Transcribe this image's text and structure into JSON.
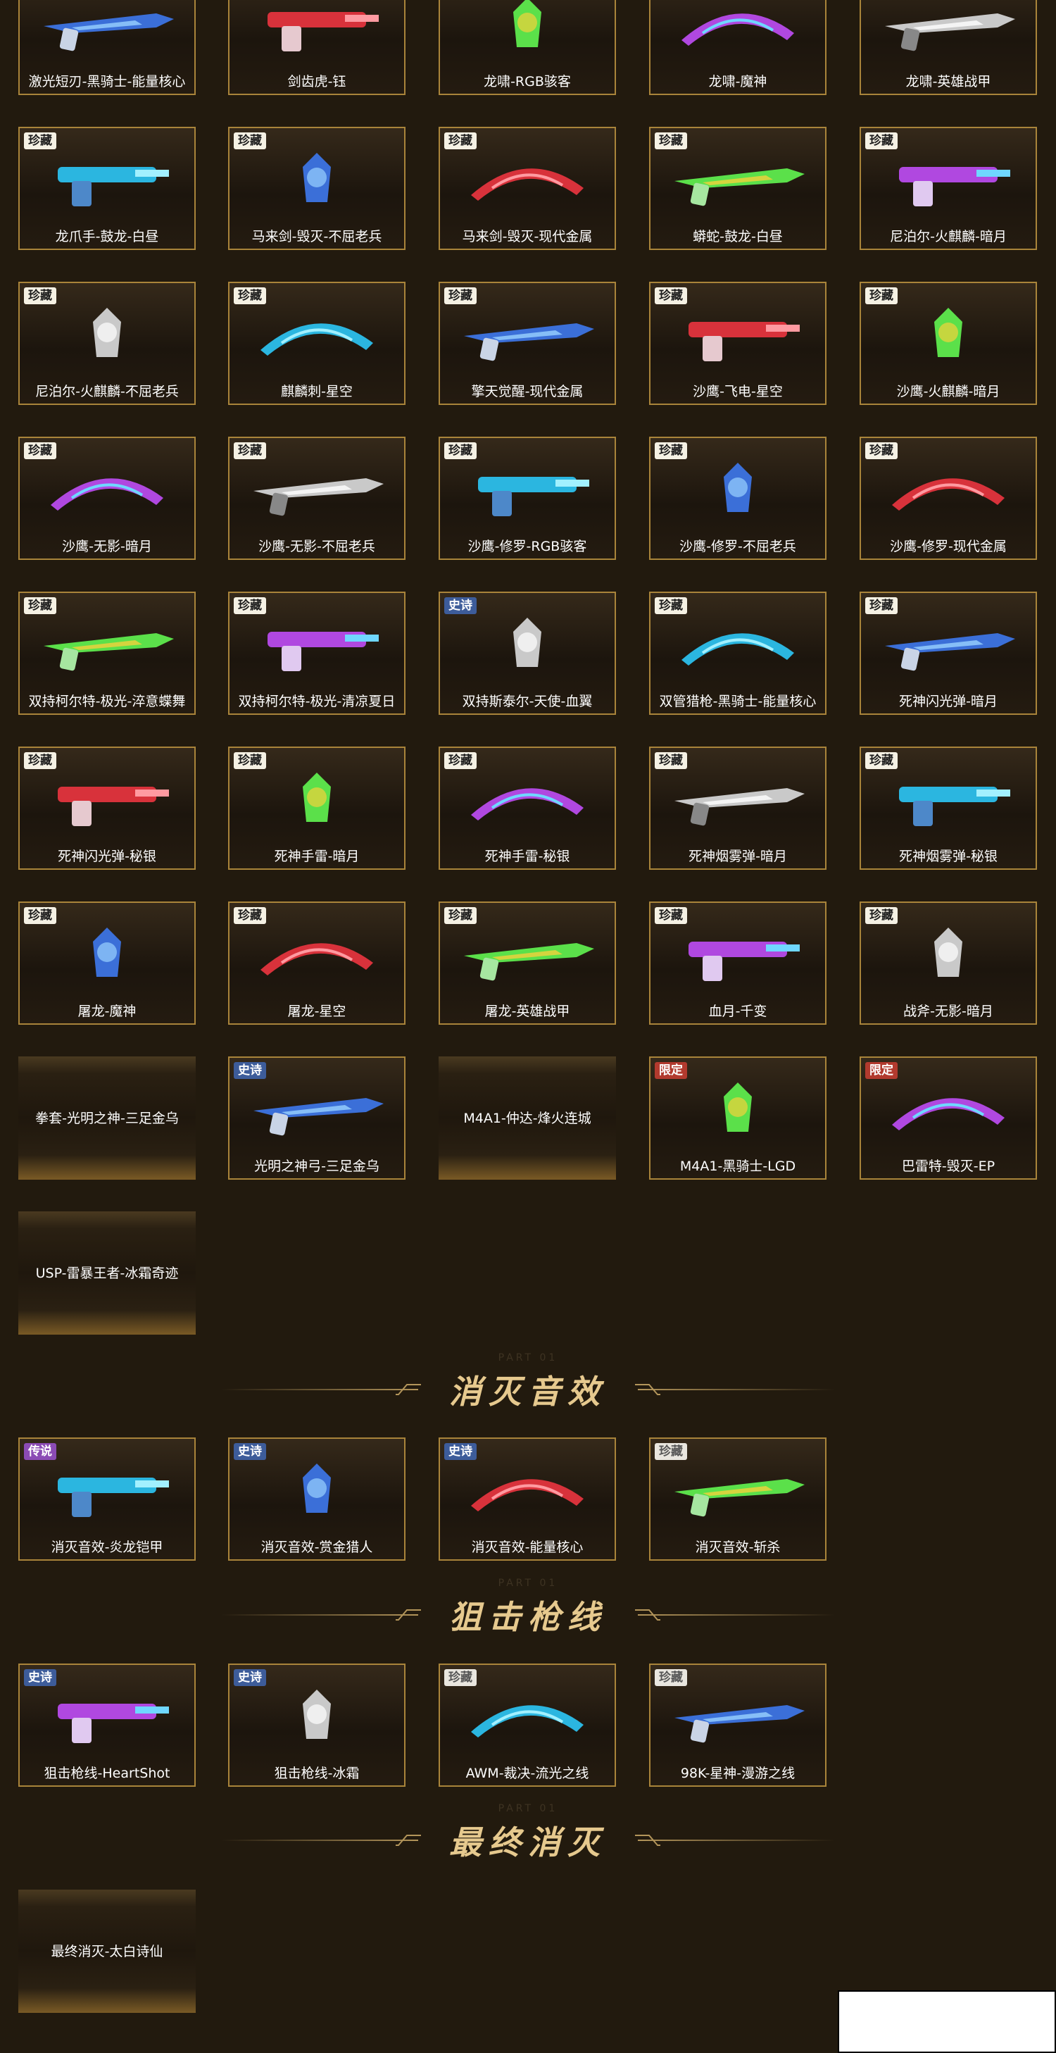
{
  "weapons": [
    [
      {
        "name": "激光短刃-黑骑士-能量核心",
        "badge": ""
      },
      {
        "name": "剑齿虎-钰",
        "badge": ""
      },
      {
        "name": "龙啸-RGB骇客",
        "badge": ""
      },
      {
        "name": "龙啸-魔神",
        "badge": ""
      },
      {
        "name": "龙啸-英雄战甲",
        "badge": ""
      }
    ],
    [
      {
        "name": "龙爪手-鼓龙-白昼",
        "badge": "珍藏"
      },
      {
        "name": "马来剑-毁灭-不屈老兵",
        "badge": "珍藏"
      },
      {
        "name": "马来剑-毁灭-现代金属",
        "badge": "珍藏"
      },
      {
        "name": "蟒蛇-鼓龙-白昼",
        "badge": "珍藏"
      },
      {
        "name": "尼泊尔-火麒麟-暗月",
        "badge": "珍藏"
      }
    ],
    [
      {
        "name": "尼泊尔-火麒麟-不屈老兵",
        "badge": "珍藏"
      },
      {
        "name": "麒麟刺-星空",
        "badge": "珍藏"
      },
      {
        "name": "擎天觉醒-现代金属",
        "badge": "珍藏"
      },
      {
        "name": "沙鹰-飞电-星空",
        "badge": "珍藏"
      },
      {
        "name": "沙鹰-火麒麟-暗月",
        "badge": "珍藏"
      }
    ],
    [
      {
        "name": "沙鹰-无影-暗月",
        "badge": "珍藏"
      },
      {
        "name": "沙鹰-无影-不屈老兵",
        "badge": "珍藏"
      },
      {
        "name": "沙鹰-修罗-RGB骇客",
        "badge": "珍藏"
      },
      {
        "name": "沙鹰-修罗-不屈老兵",
        "badge": "珍藏"
      },
      {
        "name": "沙鹰-修罗-现代金属",
        "badge": "珍藏"
      }
    ],
    [
      {
        "name": "双持柯尔特-极光-淬意蝶舞",
        "badge": "珍藏"
      },
      {
        "name": "双持柯尔特-极光-清凉夏日",
        "badge": "珍藏"
      },
      {
        "name": "双持斯泰尔-天使-血翼",
        "badge": "史诗"
      },
      {
        "name": "双管猎枪-黑骑士-能量核心",
        "badge": "珍藏"
      },
      {
        "name": "死神闪光弹-暗月",
        "badge": "珍藏"
      }
    ],
    [
      {
        "name": "死神闪光弹-秘银",
        "badge": "珍藏"
      },
      {
        "name": "死神手雷-暗月",
        "badge": "珍藏"
      },
      {
        "name": "死神手雷-秘银",
        "badge": "珍藏"
      },
      {
        "name": "死神烟雾弹-暗月",
        "badge": "珍藏"
      },
      {
        "name": "死神烟雾弹-秘银",
        "badge": "珍藏"
      }
    ],
    [
      {
        "name": "屠龙-魔神",
        "badge": "珍藏"
      },
      {
        "name": "屠龙-星空",
        "badge": "珍藏"
      },
      {
        "name": "屠龙-英雄战甲",
        "badge": "珍藏"
      },
      {
        "name": "血月-千变",
        "badge": "珍藏"
      },
      {
        "name": "战斧-无影-暗月",
        "badge": "珍藏"
      }
    ],
    [
      {
        "name": "拳套-光明之神-三足金乌",
        "badge": "",
        "plain": true
      },
      {
        "name": "光明之神弓-三足金乌",
        "badge": "史诗"
      },
      {
        "name": "M4A1-仲达-烽火连城",
        "badge": "",
        "plain": true
      },
      {
        "name": "M4A1-黑骑士-LGD",
        "badge": "限定"
      },
      {
        "name": "巴雷特-毁灭-EP",
        "badge": "限定"
      }
    ],
    [
      {
        "name": "USP-雷暴王者-冰霜奇迹",
        "badge": "",
        "plain": true
      }
    ]
  ],
  "sections": [
    {
      "title": "消灭音效",
      "part": "PART 01",
      "items": [
        {
          "name": "消灭音效-炎龙铠甲",
          "badge": "传说"
        },
        {
          "name": "消灭音效-赏金猎人",
          "badge": "史诗"
        },
        {
          "name": "消灭音效-能量核心",
          "badge": "史诗"
        },
        {
          "name": "消灭音效-斩杀",
          "badge": "珍藏"
        }
      ]
    },
    {
      "title": "狙击枪线",
      "part": "PART 01",
      "items": [
        {
          "name": "狙击枪线-HeartShot",
          "badge": "史诗"
        },
        {
          "name": "狙击枪线-冰霜",
          "badge": "史诗"
        },
        {
          "name": "AWM-裁决-流光之线",
          "badge": "珍藏"
        },
        {
          "name": "98K-星神-漫游之线",
          "badge": "珍藏"
        }
      ]
    },
    {
      "title": "最终消灭",
      "part": "PART 01",
      "items": [
        {
          "name": "最终消灭-太白诗仙",
          "badge": "",
          "plain": true
        }
      ]
    }
  ],
  "colors": {
    "background": "#221a0e",
    "card_border": "#a9843a",
    "title_gold": "#e6c98e"
  }
}
